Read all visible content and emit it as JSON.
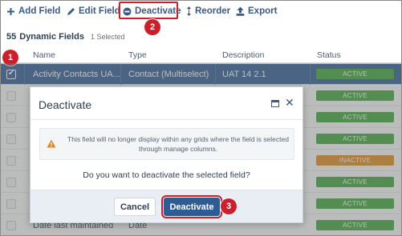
{
  "toolbar": {
    "add_field": "Add Field",
    "edit_field": "Edit Field",
    "deactivate": "Deactivate",
    "reorder": "Reorder",
    "export": "Export"
  },
  "fields_header": {
    "count": "55",
    "title": "Dynamic Fields",
    "selected": "1 Selected"
  },
  "grid": {
    "columns": [
      "Name",
      "Type",
      "Description",
      "Status"
    ],
    "selected_row": {
      "name": "Activity Contacts UA...",
      "type": "Contact (Multiselect)",
      "description": "UAT 14 2.1",
      "status": "ACTIVE"
    },
    "statuses": [
      "ACTIVE",
      "ACTIVE",
      "ACTIVE",
      "INACTIVE",
      "ACTIVE",
      "ACTIVE",
      "ACTIVE"
    ],
    "last_row": {
      "name": "Date last maintained",
      "type": "Date"
    }
  },
  "modal": {
    "title": "Deactivate",
    "warning": "This field will no longer display within any grids where the field is selected through manage columns.",
    "question": "Do you want to deactivate the selected field?",
    "cancel": "Cancel",
    "confirm": "Deactivate"
  },
  "callouts": [
    "1",
    "2",
    "3"
  ],
  "colors": {
    "accent": "#2e5c94",
    "callout": "#cc1f2b",
    "active": "#3fa63a",
    "inactive": "#e08a1e"
  }
}
